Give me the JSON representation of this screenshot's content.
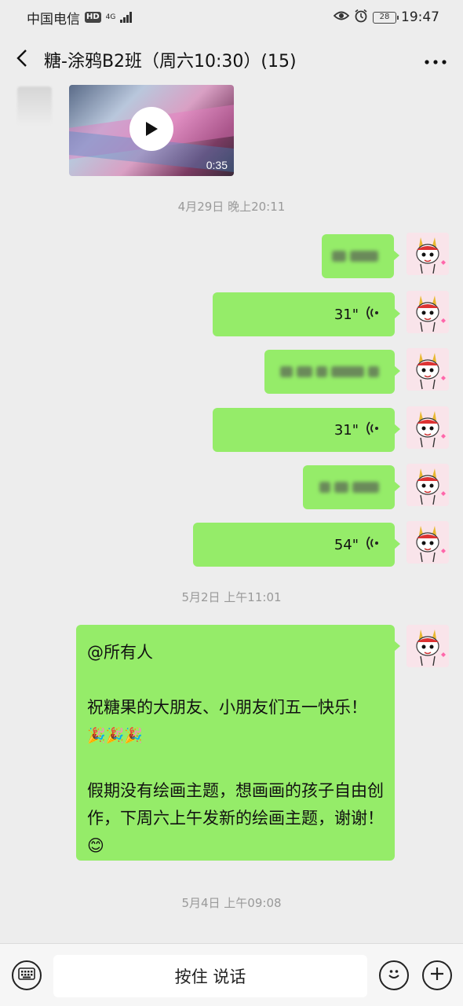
{
  "status_bar": {
    "carrier": "中国电信",
    "hd": "HD",
    "network": "4G",
    "battery": "28",
    "time": "19:47"
  },
  "header": {
    "title": "糖-涂鸦B2班（周六10:30）(15)"
  },
  "messages": {
    "video_duration": "0:35",
    "timestamp_1": "4月29日 晚上20:11",
    "voice_1": "31\"",
    "voice_2": "31\"",
    "voice_3": "54\"",
    "timestamp_2": "5月2日 上午11:01",
    "long_line_1": "@所有人",
    "long_line_2": "祝糖果的大朋友、小朋友们五一快乐！",
    "long_line_2_emoji": "🎉🎉🎉",
    "long_line_3": "假期没有绘画主题，想画画的孩子自由创作，下周六上午发新的绘画主题，谢谢！",
    "long_line_3_emoji": "😊",
    "timestamp_3": "5月4日 上午09:08"
  },
  "bottom_bar": {
    "hold_to_talk": "按住 说话"
  },
  "colors": {
    "bubble_green": "#95ec69",
    "chat_bg": "#ededed"
  }
}
